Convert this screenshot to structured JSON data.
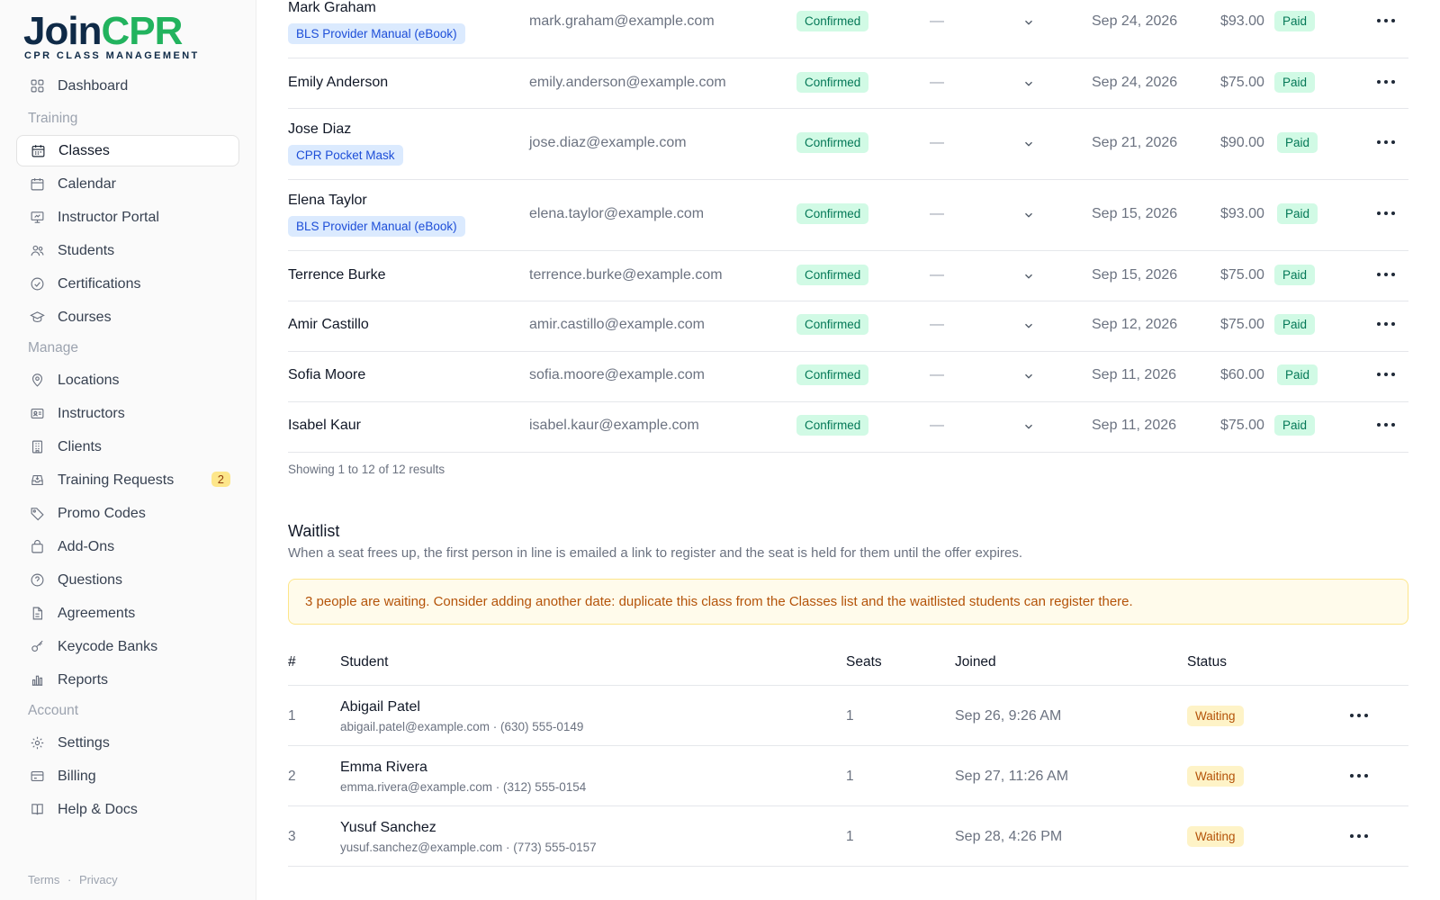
{
  "brand": {
    "name_part1": "Join",
    "name_part2": "CPR",
    "tagline": "CPR CLASS MANAGEMENT"
  },
  "sidebar": {
    "items": [
      {
        "label": "Dashboard",
        "icon": "grid-icon"
      },
      {
        "section": "Training"
      },
      {
        "label": "Classes",
        "icon": "calendar-icon",
        "active": true
      },
      {
        "label": "Calendar",
        "icon": "calendar-blank-icon"
      },
      {
        "label": "Instructor Portal",
        "icon": "presentation-icon"
      },
      {
        "label": "Students",
        "icon": "users-icon"
      },
      {
        "label": "Certifications",
        "icon": "check-circle-icon"
      },
      {
        "label": "Courses",
        "icon": "graduation-cap-icon"
      },
      {
        "section": "Manage"
      },
      {
        "label": "Locations",
        "icon": "map-pin-icon"
      },
      {
        "label": "Instructors",
        "icon": "id-card-icon"
      },
      {
        "label": "Clients",
        "icon": "building-icon"
      },
      {
        "label": "Training Requests",
        "icon": "inbox-icon",
        "badge": "2"
      },
      {
        "label": "Promo Codes",
        "icon": "tag-icon"
      },
      {
        "label": "Add-Ons",
        "icon": "shopping-bag-icon"
      },
      {
        "label": "Questions",
        "icon": "question-circle-icon"
      },
      {
        "label": "Agreements",
        "icon": "document-icon"
      },
      {
        "label": "Keycode Banks",
        "icon": "key-icon"
      },
      {
        "label": "Reports",
        "icon": "bar-chart-icon"
      },
      {
        "section": "Account"
      },
      {
        "label": "Settings",
        "icon": "gear-icon"
      },
      {
        "label": "Billing",
        "icon": "credit-card-icon"
      },
      {
        "label": "Help & Docs",
        "icon": "book-icon"
      }
    ],
    "footer": {
      "terms": "Terms",
      "separator": "·",
      "privacy": "Privacy"
    }
  },
  "registrations": {
    "rows": [
      {
        "name": "Mark Graham",
        "addon": "BLS Provider Manual (eBook)",
        "email": "mark.graham@example.com",
        "status": "Confirmed",
        "dash": "—",
        "date": "Sep 24, 2026",
        "amount": "$93.00",
        "payment": "Paid"
      },
      {
        "name": "Emily Anderson",
        "addon": "",
        "email": "emily.anderson@example.com",
        "status": "Confirmed",
        "dash": "—",
        "date": "Sep 24, 2026",
        "amount": "$75.00",
        "payment": "Paid"
      },
      {
        "name": "Jose Diaz",
        "addon": "CPR Pocket Mask",
        "email": "jose.diaz@example.com",
        "status": "Confirmed",
        "dash": "—",
        "date": "Sep 21, 2026",
        "amount": "$90.00",
        "payment": "Paid"
      },
      {
        "name": "Elena Taylor",
        "addon": "BLS Provider Manual (eBook)",
        "email": "elena.taylor@example.com",
        "status": "Confirmed",
        "dash": "—",
        "date": "Sep 15, 2026",
        "amount": "$93.00",
        "payment": "Paid"
      },
      {
        "name": "Terrence Burke",
        "addon": "",
        "email": "terrence.burke@example.com",
        "status": "Confirmed",
        "dash": "—",
        "date": "Sep 15, 2026",
        "amount": "$75.00",
        "payment": "Paid"
      },
      {
        "name": "Amir Castillo",
        "addon": "",
        "email": "amir.castillo@example.com",
        "status": "Confirmed",
        "dash": "—",
        "date": "Sep 12, 2026",
        "amount": "$75.00",
        "payment": "Paid"
      },
      {
        "name": "Sofia Moore",
        "addon": "",
        "email": "sofia.moore@example.com",
        "status": "Confirmed",
        "dash": "—",
        "date": "Sep 11, 2026",
        "amount": "$60.00",
        "payment": "Paid"
      },
      {
        "name": "Isabel Kaur",
        "addon": "",
        "email": "isabel.kaur@example.com",
        "status": "Confirmed",
        "dash": "—",
        "date": "Sep 11, 2026",
        "amount": "$75.00",
        "payment": "Paid"
      }
    ],
    "showing": "Showing 1 to 12 of 12 results"
  },
  "waitlist": {
    "title": "Waitlist",
    "description": "When a seat frees up, the first person in line is emailed a link to register and the seat is held for them until the offer expires.",
    "alert": "3 people are waiting. Consider adding another date: duplicate this class from the Classes list and the waitlisted students can register there.",
    "columns": {
      "num": "#",
      "student": "Student",
      "seats": "Seats",
      "joined": "Joined",
      "status": "Status"
    },
    "rows": [
      {
        "num": "1",
        "name": "Abigail Patel",
        "contact": "abigail.patel@example.com · (630) 555-0149",
        "seats": "1",
        "joined": "Sep 26, 9:26 AM",
        "status": "Waiting"
      },
      {
        "num": "2",
        "name": "Emma Rivera",
        "contact": "emma.rivera@example.com · (312) 555-0154",
        "seats": "1",
        "joined": "Sep 27, 11:26 AM",
        "status": "Waiting"
      },
      {
        "num": "3",
        "name": "Yusuf Sanchez",
        "contact": "yusuf.sanchez@example.com · (773) 555-0157",
        "seats": "1",
        "joined": "Sep 28, 4:26 PM",
        "status": "Waiting"
      }
    ]
  },
  "colors": {
    "brand_navy": "#0f2a47",
    "brand_green": "#22b35e",
    "confirmed": "#047857",
    "waiting": "#b45309",
    "addon": "#1d4ed8"
  }
}
